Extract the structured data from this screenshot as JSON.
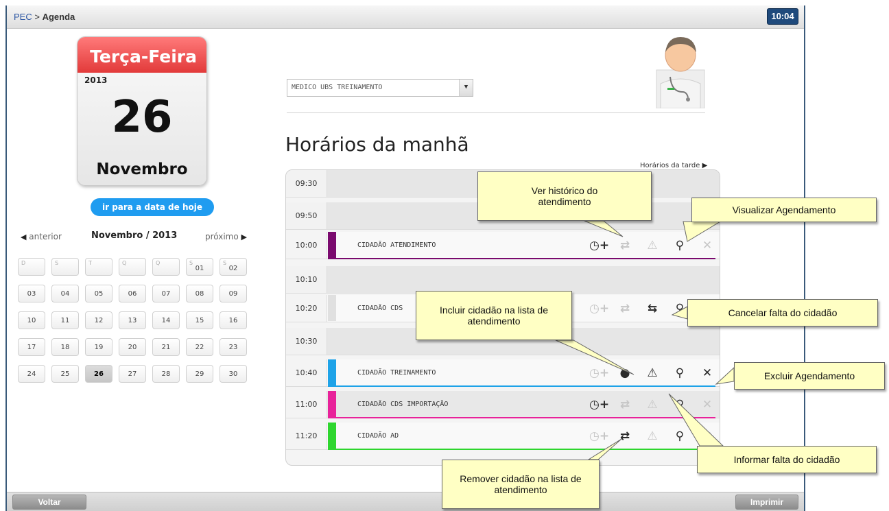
{
  "breadcrumb": {
    "root": "PEC",
    "separator": " > ",
    "current": "Agenda"
  },
  "clock": "10:04",
  "calendar_card": {
    "weekday": "Terça-Feira",
    "year": "2013",
    "day": "26",
    "month": "Novembro"
  },
  "today_button": "ir para a data de hoje",
  "month_nav": {
    "prev": "anterior",
    "title": "Novembro / 2013",
    "next": "próximo"
  },
  "weekday_headers": [
    "D",
    "S",
    "T",
    "Q",
    "Q",
    "S",
    "S"
  ],
  "calendar_days": [
    [
      "",
      "",
      "",
      "",
      "",
      "01",
      "02"
    ],
    [
      "03",
      "04",
      "05",
      "06",
      "07",
      "08",
      "09"
    ],
    [
      "10",
      "11",
      "12",
      "13",
      "14",
      "15",
      "16"
    ],
    [
      "17",
      "18",
      "19",
      "20",
      "21",
      "22",
      "23"
    ],
    [
      "24",
      "25",
      "26",
      "27",
      "28",
      "29",
      "30"
    ]
  ],
  "selected_day": "26",
  "professional_select": {
    "value": "MEDICO UBS TREINAMENTO"
  },
  "section_title": "Horários da manhã",
  "afternoon_link": "Horários da tarde",
  "schedule": [
    {
      "time": "09:30",
      "name": "",
      "color": ""
    },
    {
      "time": "09:50",
      "name": "",
      "color": ""
    },
    {
      "time": "10:00",
      "name": "CIDADÃO ATENDIMENTO",
      "color": "#7a0a6e"
    },
    {
      "time": "10:10",
      "name": "",
      "color": ""
    },
    {
      "time": "10:20",
      "name": "CIDADÃO CDS",
      "color": ""
    },
    {
      "time": "10:30",
      "name": "",
      "color": ""
    },
    {
      "time": "10:40",
      "name": "CIDADÃO TREINAMENTO",
      "color": "#1ea3e8"
    },
    {
      "time": "11:00",
      "name": "CIDADÃO CDS IMPORTAÇÃO",
      "color": "#e8229a"
    },
    {
      "time": "11:20",
      "name": "CIDADÃO AD",
      "color": "#2ed62e"
    }
  ],
  "callouts": {
    "historico": "Ver histórico do atendimento",
    "visualizar": "Visualizar Agendamento",
    "incluir": "Incluir cidadão na lista de atendimento",
    "cancelar_falta": "Cancelar falta do cidadão",
    "excluir": "Excluir Agendamento",
    "informar_falta": "Informar falta do cidadão",
    "remover": "Remover cidadão na lista de atendimento"
  },
  "buttons": {
    "back": "Voltar",
    "print": "Imprimir"
  },
  "icons": [
    "clock-plus-icon",
    "person-transfer-icon",
    "person-warning-icon",
    "search-icon",
    "close-icon"
  ]
}
